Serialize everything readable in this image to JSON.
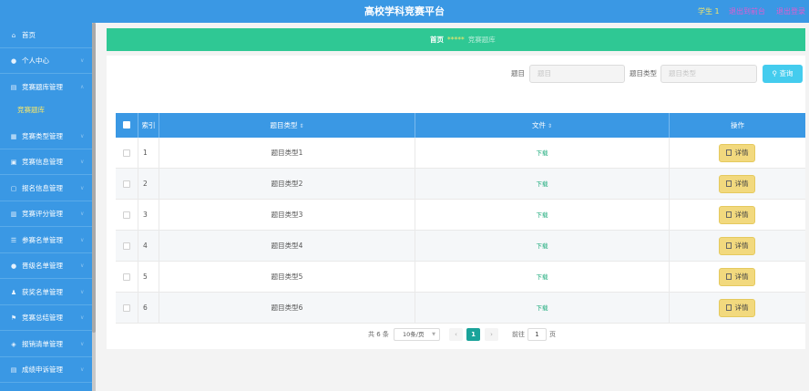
{
  "header": {
    "title": "高校学科竞赛平台",
    "user": "学生 1",
    "link_front": "退出到前台",
    "link_logout": "退出登录"
  },
  "sidebar": {
    "items": [
      {
        "label": "首页",
        "icon": "home-icon"
      },
      {
        "label": "个人中心",
        "icon": "person-icon"
      },
      {
        "label": "竞赛题库管理",
        "icon": "book-icon"
      },
      {
        "label": "竞赛类型管理",
        "icon": "grid-icon"
      },
      {
        "label": "竞赛信息管理",
        "icon": "info-icon"
      },
      {
        "label": "报名信息管理",
        "icon": "form-icon"
      },
      {
        "label": "竞赛评分管理",
        "icon": "score-icon"
      },
      {
        "label": "参赛名单管理",
        "icon": "list-icon"
      },
      {
        "label": "晋级名单管理",
        "icon": "user-icon"
      },
      {
        "label": "获奖名单管理",
        "icon": "award-icon"
      },
      {
        "label": "竞赛总结管理",
        "icon": "flag-icon"
      },
      {
        "label": "报销清单管理",
        "icon": "receipt-icon"
      },
      {
        "label": "成绩申诉管理",
        "icon": "doc-icon"
      }
    ],
    "sub_active": "竞赛题库"
  },
  "breadcrumb": {
    "home": "首页",
    "separator": "*****",
    "current": "竞赛题库"
  },
  "search": {
    "title_label": "题目",
    "title_placeholder": "题目",
    "type_label": "题目类型",
    "type_placeholder": "题目类型",
    "button": "查询"
  },
  "table": {
    "columns": [
      "索引",
      "题目类型",
      "文件",
      "操作"
    ],
    "rows": [
      {
        "index": "1",
        "type": "题目类型1",
        "file": "下载",
        "action": "详情"
      },
      {
        "index": "2",
        "type": "题目类型2",
        "file": "下载",
        "action": "详情"
      },
      {
        "index": "3",
        "type": "题目类型3",
        "file": "下载",
        "action": "详情"
      },
      {
        "index": "4",
        "type": "题目类型4",
        "file": "下载",
        "action": "详情"
      },
      {
        "index": "5",
        "type": "题目类型5",
        "file": "下载",
        "action": "详情"
      },
      {
        "index": "6",
        "type": "题目类型6",
        "file": "下载",
        "action": "详情"
      }
    ]
  },
  "pagination": {
    "total": "共 6 条",
    "page_size": "10条/页",
    "current": "1",
    "goto_label": "前往",
    "goto_value": "1",
    "page_suffix": "页"
  },
  "colors": {
    "sidebar": "#3a98e4",
    "banner": "#2fc894",
    "query_button": "#44ccee",
    "detail_button": "#f2d97e",
    "active_page": "#1aa39a"
  }
}
